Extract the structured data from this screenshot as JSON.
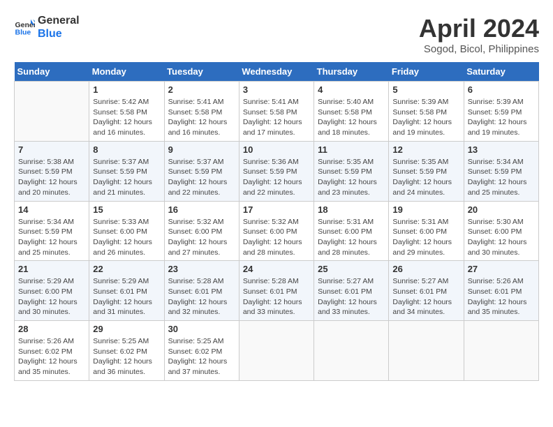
{
  "header": {
    "logo_line1": "General",
    "logo_line2": "Blue",
    "month": "April 2024",
    "location": "Sogod, Bicol, Philippines"
  },
  "days_of_week": [
    "Sunday",
    "Monday",
    "Tuesday",
    "Wednesday",
    "Thursday",
    "Friday",
    "Saturday"
  ],
  "weeks": [
    [
      {
        "day": "",
        "info": ""
      },
      {
        "day": "1",
        "info": "Sunrise: 5:42 AM\nSunset: 5:58 PM\nDaylight: 12 hours\nand 16 minutes."
      },
      {
        "day": "2",
        "info": "Sunrise: 5:41 AM\nSunset: 5:58 PM\nDaylight: 12 hours\nand 16 minutes."
      },
      {
        "day": "3",
        "info": "Sunrise: 5:41 AM\nSunset: 5:58 PM\nDaylight: 12 hours\nand 17 minutes."
      },
      {
        "day": "4",
        "info": "Sunrise: 5:40 AM\nSunset: 5:58 PM\nDaylight: 12 hours\nand 18 minutes."
      },
      {
        "day": "5",
        "info": "Sunrise: 5:39 AM\nSunset: 5:58 PM\nDaylight: 12 hours\nand 19 minutes."
      },
      {
        "day": "6",
        "info": "Sunrise: 5:39 AM\nSunset: 5:59 PM\nDaylight: 12 hours\nand 19 minutes."
      }
    ],
    [
      {
        "day": "7",
        "info": "Sunrise: 5:38 AM\nSunset: 5:59 PM\nDaylight: 12 hours\nand 20 minutes."
      },
      {
        "day": "8",
        "info": "Sunrise: 5:37 AM\nSunset: 5:59 PM\nDaylight: 12 hours\nand 21 minutes."
      },
      {
        "day": "9",
        "info": "Sunrise: 5:37 AM\nSunset: 5:59 PM\nDaylight: 12 hours\nand 22 minutes."
      },
      {
        "day": "10",
        "info": "Sunrise: 5:36 AM\nSunset: 5:59 PM\nDaylight: 12 hours\nand 22 minutes."
      },
      {
        "day": "11",
        "info": "Sunrise: 5:35 AM\nSunset: 5:59 PM\nDaylight: 12 hours\nand 23 minutes."
      },
      {
        "day": "12",
        "info": "Sunrise: 5:35 AM\nSunset: 5:59 PM\nDaylight: 12 hours\nand 24 minutes."
      },
      {
        "day": "13",
        "info": "Sunrise: 5:34 AM\nSunset: 5:59 PM\nDaylight: 12 hours\nand 25 minutes."
      }
    ],
    [
      {
        "day": "14",
        "info": "Sunrise: 5:34 AM\nSunset: 5:59 PM\nDaylight: 12 hours\nand 25 minutes."
      },
      {
        "day": "15",
        "info": "Sunrise: 5:33 AM\nSunset: 6:00 PM\nDaylight: 12 hours\nand 26 minutes."
      },
      {
        "day": "16",
        "info": "Sunrise: 5:32 AM\nSunset: 6:00 PM\nDaylight: 12 hours\nand 27 minutes."
      },
      {
        "day": "17",
        "info": "Sunrise: 5:32 AM\nSunset: 6:00 PM\nDaylight: 12 hours\nand 28 minutes."
      },
      {
        "day": "18",
        "info": "Sunrise: 5:31 AM\nSunset: 6:00 PM\nDaylight: 12 hours\nand 28 minutes."
      },
      {
        "day": "19",
        "info": "Sunrise: 5:31 AM\nSunset: 6:00 PM\nDaylight: 12 hours\nand 29 minutes."
      },
      {
        "day": "20",
        "info": "Sunrise: 5:30 AM\nSunset: 6:00 PM\nDaylight: 12 hours\nand 30 minutes."
      }
    ],
    [
      {
        "day": "21",
        "info": "Sunrise: 5:29 AM\nSunset: 6:00 PM\nDaylight: 12 hours\nand 30 minutes."
      },
      {
        "day": "22",
        "info": "Sunrise: 5:29 AM\nSunset: 6:01 PM\nDaylight: 12 hours\nand 31 minutes."
      },
      {
        "day": "23",
        "info": "Sunrise: 5:28 AM\nSunset: 6:01 PM\nDaylight: 12 hours\nand 32 minutes."
      },
      {
        "day": "24",
        "info": "Sunrise: 5:28 AM\nSunset: 6:01 PM\nDaylight: 12 hours\nand 33 minutes."
      },
      {
        "day": "25",
        "info": "Sunrise: 5:27 AM\nSunset: 6:01 PM\nDaylight: 12 hours\nand 33 minutes."
      },
      {
        "day": "26",
        "info": "Sunrise: 5:27 AM\nSunset: 6:01 PM\nDaylight: 12 hours\nand 34 minutes."
      },
      {
        "day": "27",
        "info": "Sunrise: 5:26 AM\nSunset: 6:01 PM\nDaylight: 12 hours\nand 35 minutes."
      }
    ],
    [
      {
        "day": "28",
        "info": "Sunrise: 5:26 AM\nSunset: 6:02 PM\nDaylight: 12 hours\nand 35 minutes."
      },
      {
        "day": "29",
        "info": "Sunrise: 5:25 AM\nSunset: 6:02 PM\nDaylight: 12 hours\nand 36 minutes."
      },
      {
        "day": "30",
        "info": "Sunrise: 5:25 AM\nSunset: 6:02 PM\nDaylight: 12 hours\nand 37 minutes."
      },
      {
        "day": "",
        "info": ""
      },
      {
        "day": "",
        "info": ""
      },
      {
        "day": "",
        "info": ""
      },
      {
        "day": "",
        "info": ""
      }
    ]
  ]
}
